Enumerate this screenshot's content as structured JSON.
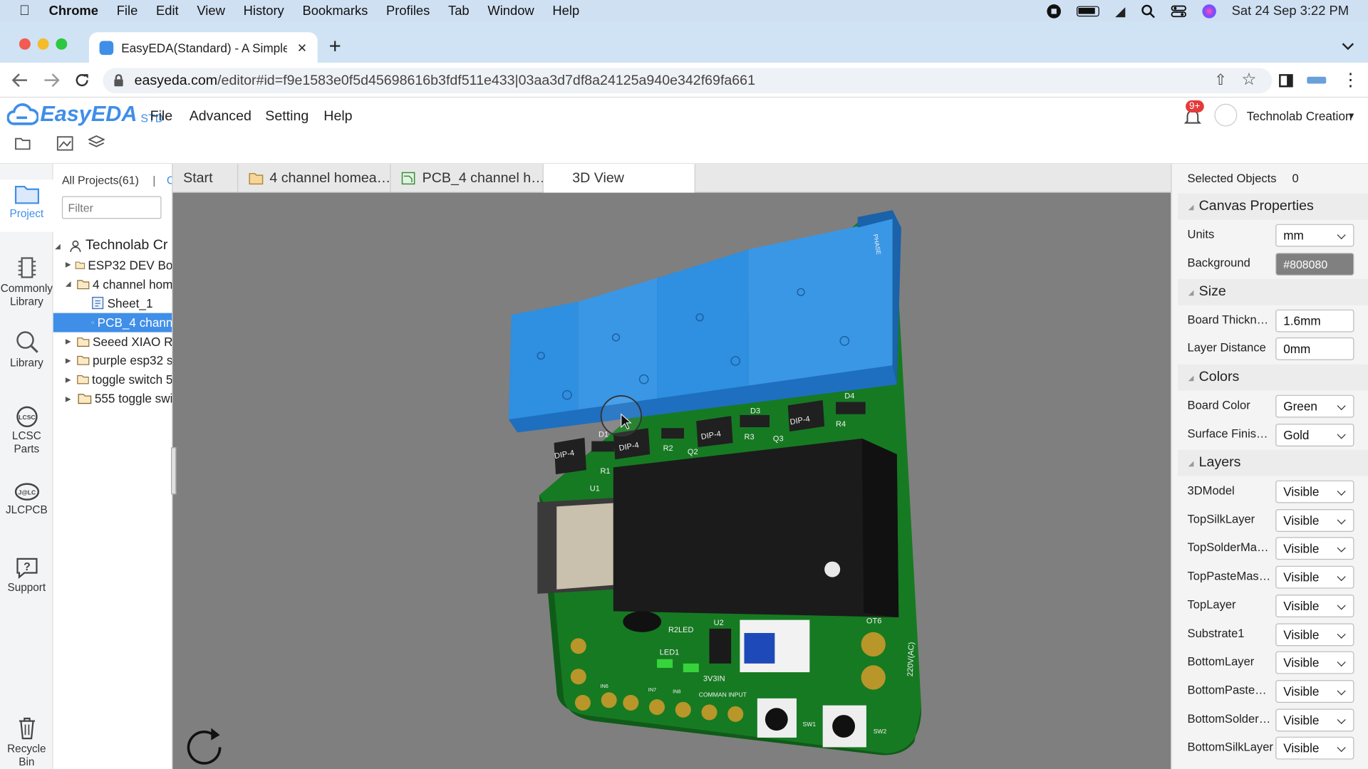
{
  "menubar": {
    "app": "Chrome",
    "items": [
      "File",
      "Edit",
      "View",
      "History",
      "Bookmarks",
      "Profiles",
      "Tab",
      "Window",
      "Help"
    ],
    "datetime": "Sat 24 Sep  3:22 PM"
  },
  "browser": {
    "tab_title": "EasyEDA(Standard) - A Simple",
    "url_host": "easyeda.com",
    "url_path": "/editor#id=f9e1583e0f5d45698616b3fdf511e433|03aa3d7df8a24125a940e342f69fa661"
  },
  "app": {
    "logo": "EasyEDA",
    "logo_suffix": "STD",
    "menu": [
      "File",
      "Advanced",
      "Setting",
      "Help"
    ],
    "notif_badge": "9+",
    "user": "Technolab Creation"
  },
  "rail": [
    "Project",
    "Commonly Library",
    "Library",
    "LCSC Parts",
    "JLCPCB",
    "Support",
    "Recycle Bin"
  ],
  "projects": {
    "header": "All Projects(61)",
    "separator": "|",
    "filter_placeholder": "Filter",
    "tree": [
      {
        "label": "Technolab Cr",
        "level": 0,
        "kind": "user",
        "open": true
      },
      {
        "label": "ESP32 DEV Bo",
        "level": 1,
        "kind": "folder"
      },
      {
        "label": "4 channel hom",
        "level": 1,
        "kind": "folder",
        "open": true
      },
      {
        "label": "Sheet_1",
        "level": 2,
        "kind": "sheet"
      },
      {
        "label": "PCB_4 chann",
        "level": 2,
        "kind": "pcb",
        "selected": true
      },
      {
        "label": "Seeed XIAO R",
        "level": 1,
        "kind": "folder"
      },
      {
        "label": "purple esp32 s",
        "level": 1,
        "kind": "folder"
      },
      {
        "label": "toggle switch 5",
        "level": 1,
        "kind": "folder"
      },
      {
        "label": "555 toggle swi",
        "level": 1,
        "kind": "folder"
      }
    ]
  },
  "doctabs": [
    "Start",
    "4 channel homea…",
    "PCB_4 channel h…",
    "3D View"
  ],
  "board": {
    "silk": [
      "DIP-4",
      "DIP-4",
      "DIP-4",
      "DIP-4",
      "D1",
      "D3",
      "D4",
      "R1",
      "R2",
      "R3",
      "R4",
      "Q2",
      "Q3",
      "U1",
      "U2",
      "R2LED",
      "LED1",
      "3V3IN",
      "COMMAN INPUT",
      "IN6",
      "IN7",
      "IN8",
      "220V(AC)",
      "OT6",
      "SW1",
      "SW2",
      "PHASE"
    ]
  },
  "panel": {
    "selected_label": "Selected Objects",
    "selected_count": "0",
    "canvas_title": "Canvas Properties",
    "units_label": "Units",
    "units": "mm",
    "bg_label": "Background",
    "bg": "#808080",
    "size_title": "Size",
    "thick_label": "Board Thickn…",
    "thick": "1.6mm",
    "layer_dist_label": "Layer Distance",
    "layer_dist": "0mm",
    "colors_title": "Colors",
    "board_color_label": "Board Color",
    "board_color": "Green",
    "finish_label": "Surface Finis…",
    "finish": "Gold",
    "layers_title": "Layers",
    "layers": [
      {
        "name": "3DModel",
        "value": "Visible"
      },
      {
        "name": "TopSilkLayer",
        "value": "Visible"
      },
      {
        "name": "TopSolderMa…",
        "value": "Visible"
      },
      {
        "name": "TopPasteMas…",
        "value": "Visible"
      },
      {
        "name": "TopLayer",
        "value": "Visible"
      },
      {
        "name": "Substrate1",
        "value": "Visible"
      },
      {
        "name": "BottomLayer",
        "value": "Visible"
      },
      {
        "name": "BottomPaste…",
        "value": "Visible"
      },
      {
        "name": "BottomSolder…",
        "value": "Visible"
      },
      {
        "name": "BottomSilkLayer",
        "value": "Visible"
      }
    ]
  },
  "colors": {
    "board": "#1e8a2a",
    "relay": "#2f8fe0",
    "canvas": "#808080",
    "selection": "#3f8ee8"
  }
}
